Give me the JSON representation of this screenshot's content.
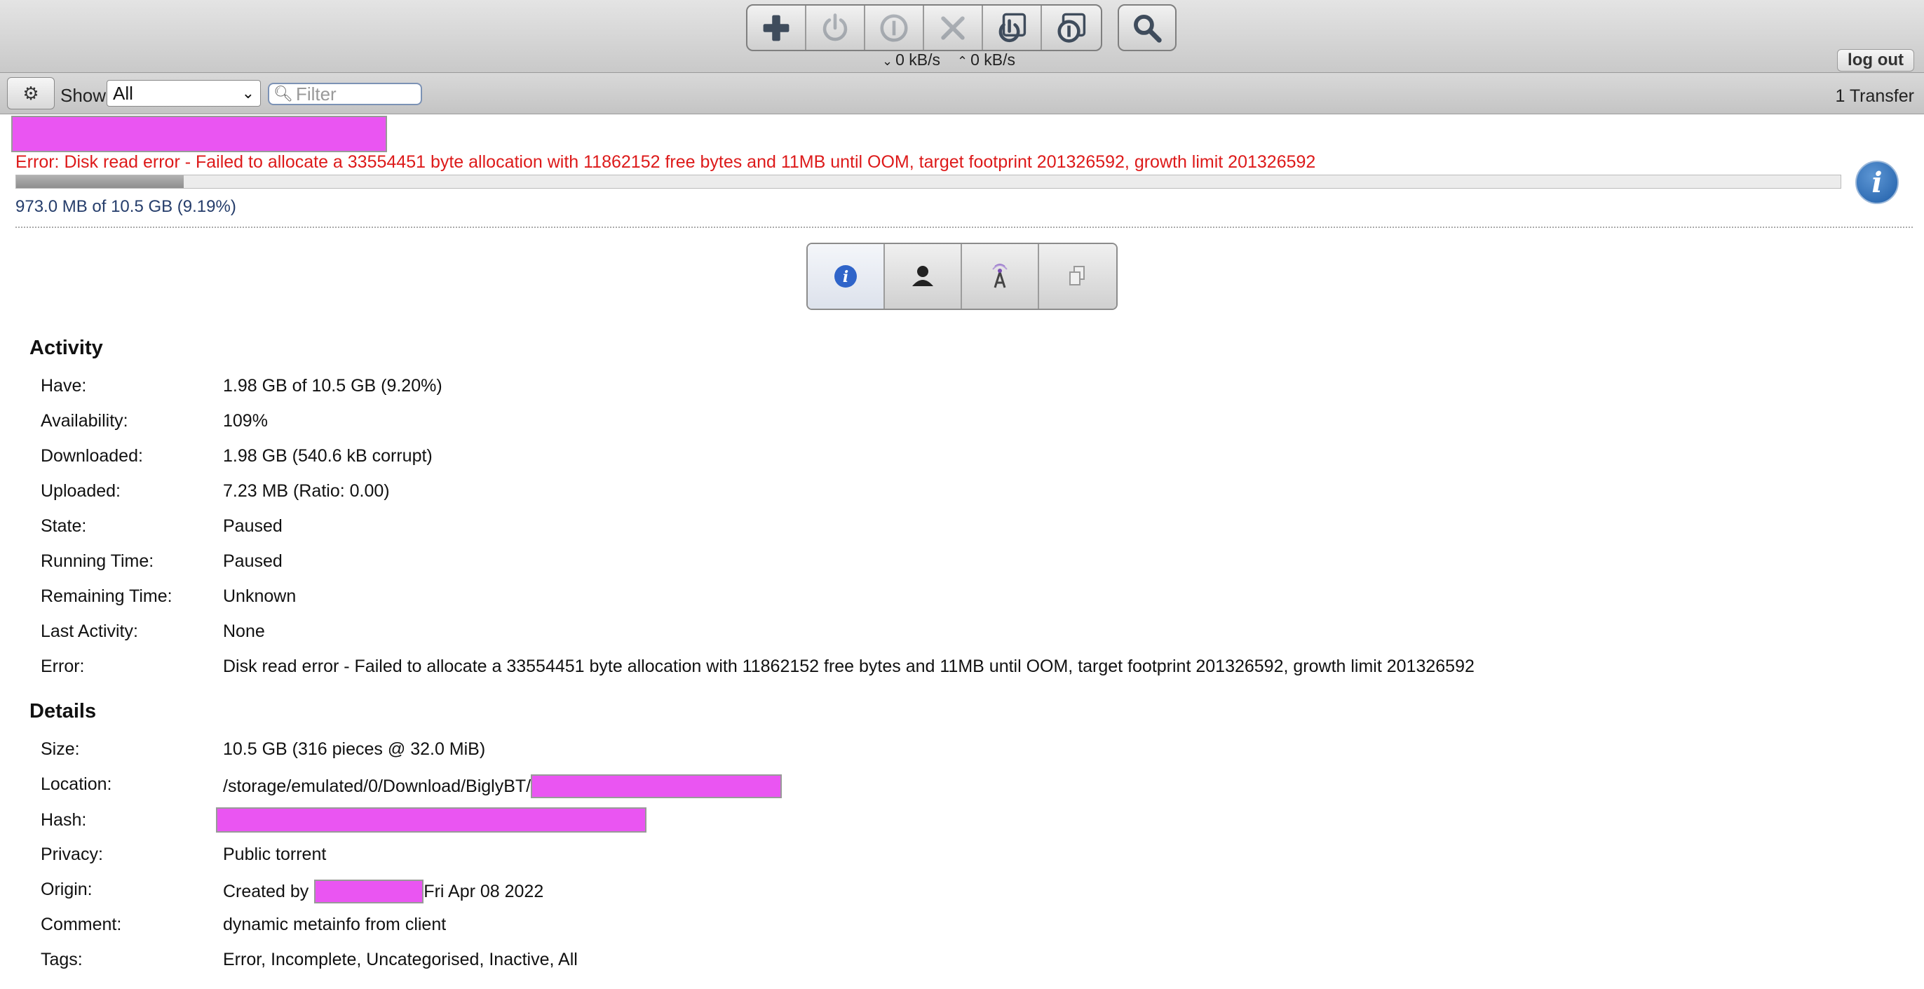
{
  "toolbar": {
    "buttons": [
      {
        "icon": "plus-icon",
        "label": "Open torrent"
      },
      {
        "icon": "power-icon",
        "label": "Start"
      },
      {
        "icon": "pause-icon",
        "label": "Pause"
      },
      {
        "icon": "close-icon",
        "label": "Remove"
      },
      {
        "icon": "start-all-icon",
        "label": "Start all"
      },
      {
        "icon": "pause-all-icon",
        "label": "Pause all"
      },
      {
        "icon": "search-icon",
        "label": "Inspector"
      }
    ],
    "download_rate": "0 kB/s",
    "upload_rate": "0 kB/s",
    "logout_label": "log out"
  },
  "filterbar": {
    "show_label": "Show",
    "show_value": "All",
    "filter_placeholder": "Filter",
    "transfer_count": "1 Transfer"
  },
  "torrent": {
    "error_text": "Error: Disk read error - Failed to allocate a 33554451 byte allocation with 11862152 free bytes and 11MB until OOM, target footprint 201326592, growth limit 201326592",
    "progress_percent": 9.19,
    "progress_text": "973.0 MB of 10.5 GB (9.19%)",
    "info_icon": "info-icon"
  },
  "inspector_tabs": [
    {
      "icon": "info-icon",
      "active": true
    },
    {
      "icon": "peers-icon",
      "active": false
    },
    {
      "icon": "trackers-icon",
      "active": false
    },
    {
      "icon": "files-icon",
      "active": false
    }
  ],
  "activity": {
    "title": "Activity",
    "rows": [
      {
        "key": "Have:",
        "value": "1.98 GB of 10.5 GB (9.20%)"
      },
      {
        "key": "Availability:",
        "value": "109%"
      },
      {
        "key": "Downloaded:",
        "value": "1.98 GB (540.6 kB corrupt)"
      },
      {
        "key": "Uploaded:",
        "value": "7.23 MB (Ratio: 0.00)"
      },
      {
        "key": "State:",
        "value": "Paused"
      },
      {
        "key": "Running Time:",
        "value": "Paused"
      },
      {
        "key": "Remaining Time:",
        "value": "Unknown"
      },
      {
        "key": "Last Activity:",
        "value": "None"
      },
      {
        "key": "Error:",
        "value": "Disk read error - Failed to allocate a 33554451 byte allocation with 11862152 free bytes and 11MB until OOM, target footprint 201326592, growth limit 201326592"
      }
    ]
  },
  "details": {
    "title": "Details",
    "size_key": "Size:",
    "size_value": "10.5 GB (316 pieces @ 32.0 MiB)",
    "location_key": "Location:",
    "location_prefix": "/storage/emulated/0/Download/BiglyBT/",
    "hash_key": "Hash:",
    "privacy_key": "Privacy:",
    "privacy_value": "Public torrent",
    "origin_key": "Origin:",
    "origin_prefix": "Created by",
    "origin_suffix": "Fri Apr 08 2022",
    "comment_key": "Comment:",
    "comment_value": "dynamic metainfo from client",
    "tags_key": "Tags:",
    "tags_value": "Error, Incomplete, Uncategorised, Inactive, All"
  }
}
